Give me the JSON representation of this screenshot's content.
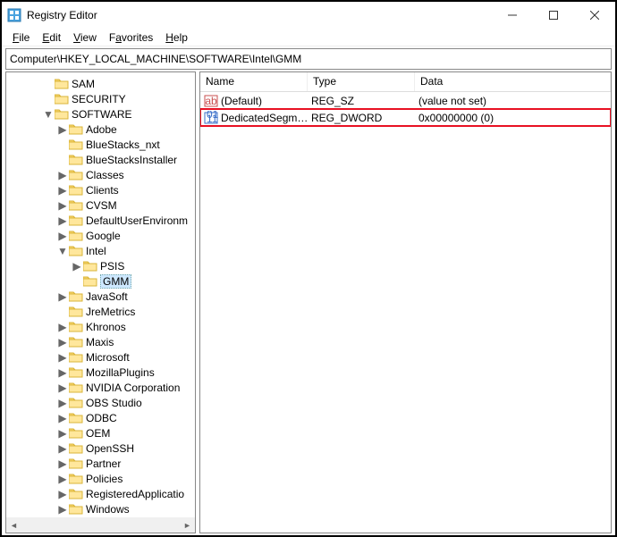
{
  "window": {
    "title": "Registry Editor"
  },
  "menubar": {
    "file": "File",
    "edit": "Edit",
    "view": "View",
    "favorites": "Favorites",
    "help": "Help"
  },
  "address": "Computer\\HKEY_LOCAL_MACHINE\\SOFTWARE\\Intel\\GMM",
  "tree": {
    "items": [
      {
        "depth": 2,
        "tw": "",
        "label": "SAM"
      },
      {
        "depth": 2,
        "tw": "",
        "label": "SECURITY"
      },
      {
        "depth": 2,
        "tw": "v",
        "label": "SOFTWARE"
      },
      {
        "depth": 3,
        "tw": ">",
        "label": "Adobe"
      },
      {
        "depth": 3,
        "tw": "",
        "label": "BlueStacks_nxt"
      },
      {
        "depth": 3,
        "tw": "",
        "label": "BlueStacksInstaller"
      },
      {
        "depth": 3,
        "tw": ">",
        "label": "Classes"
      },
      {
        "depth": 3,
        "tw": ">",
        "label": "Clients"
      },
      {
        "depth": 3,
        "tw": ">",
        "label": "CVSM"
      },
      {
        "depth": 3,
        "tw": ">",
        "label": "DefaultUserEnvironm"
      },
      {
        "depth": 3,
        "tw": ">",
        "label": "Google"
      },
      {
        "depth": 3,
        "tw": "v",
        "label": "Intel"
      },
      {
        "depth": 4,
        "tw": ">",
        "label": "PSIS"
      },
      {
        "depth": 4,
        "tw": "",
        "label": "GMM",
        "selected": true
      },
      {
        "depth": 3,
        "tw": ">",
        "label": "JavaSoft"
      },
      {
        "depth": 3,
        "tw": "",
        "label": "JreMetrics"
      },
      {
        "depth": 3,
        "tw": ">",
        "label": "Khronos"
      },
      {
        "depth": 3,
        "tw": ">",
        "label": "Maxis"
      },
      {
        "depth": 3,
        "tw": ">",
        "label": "Microsoft"
      },
      {
        "depth": 3,
        "tw": ">",
        "label": "MozillaPlugins"
      },
      {
        "depth": 3,
        "tw": ">",
        "label": "NVIDIA Corporation"
      },
      {
        "depth": 3,
        "tw": ">",
        "label": "OBS Studio"
      },
      {
        "depth": 3,
        "tw": ">",
        "label": "ODBC"
      },
      {
        "depth": 3,
        "tw": ">",
        "label": "OEM"
      },
      {
        "depth": 3,
        "tw": ">",
        "label": "OpenSSH"
      },
      {
        "depth": 3,
        "tw": ">",
        "label": "Partner"
      },
      {
        "depth": 3,
        "tw": ">",
        "label": "Policies"
      },
      {
        "depth": 3,
        "tw": ">",
        "label": "RegisteredApplicatio"
      },
      {
        "depth": 3,
        "tw": ">",
        "label": "Windows"
      }
    ]
  },
  "list": {
    "cols": {
      "name": "Name",
      "type": "Type",
      "data": "Data"
    },
    "rows": [
      {
        "icon": "sz",
        "name": "(Default)",
        "type": "REG_SZ",
        "data": "(value not set)",
        "highlight": false
      },
      {
        "icon": "dw",
        "name": "DedicatedSegm…",
        "type": "REG_DWORD",
        "data": "0x00000000 (0)",
        "highlight": true
      }
    ]
  }
}
